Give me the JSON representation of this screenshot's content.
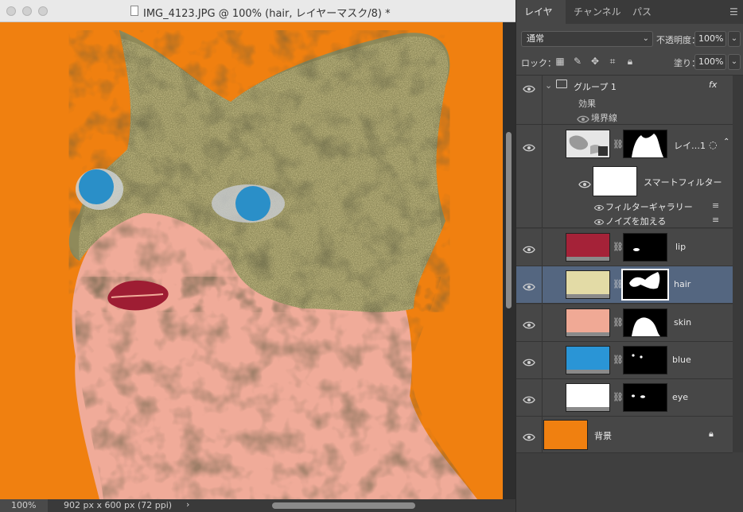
{
  "window": {
    "title": "IMG_4123.JPG @ 100% (hair, レイヤーマスク/8) *"
  },
  "status": {
    "zoom": "100%",
    "doc_info": "902 px x 600 px (72 ppi)",
    "arrow": "›"
  },
  "panel": {
    "tabs": [
      "レイヤー",
      "チャンネル",
      "パス"
    ],
    "active_tab": "レイヤー",
    "blend_mode": "通常",
    "opacity_label": "不透明度：",
    "opacity_value": "100%",
    "lock_label": "ロック：",
    "fill_label": "塗り：",
    "fill_value": "100%"
  },
  "layers": {
    "group": {
      "name": "グループ 1",
      "fx": "fx",
      "effects_label": "効果",
      "stroke_label": "境界線"
    },
    "smart": {
      "name": "レイ…1",
      "smart_filters_label": "スマートフィルター",
      "filters": [
        "フィルターギャラリー",
        "ノイズを加える"
      ]
    },
    "color_layers": [
      {
        "name": "lip",
        "color": "#a52238"
      },
      {
        "name": "hair",
        "color": "#e3dba6",
        "selected": true
      },
      {
        "name": "skin",
        "color": "#f0a995"
      },
      {
        "name": "blue",
        "color": "#2a95d6"
      },
      {
        "name": "eye",
        "color": "#ffffff"
      }
    ],
    "background": {
      "name": "背景",
      "color": "#f08010"
    }
  },
  "colors": {
    "canvas_bg": "#f08010",
    "hair": "#8f8a5a",
    "hair_light": "#e8dea4",
    "skin": "#f0ab99",
    "lip": "#9e1d33",
    "eye_blue": "#2a8fc8",
    "selected_row": "#546680"
  }
}
